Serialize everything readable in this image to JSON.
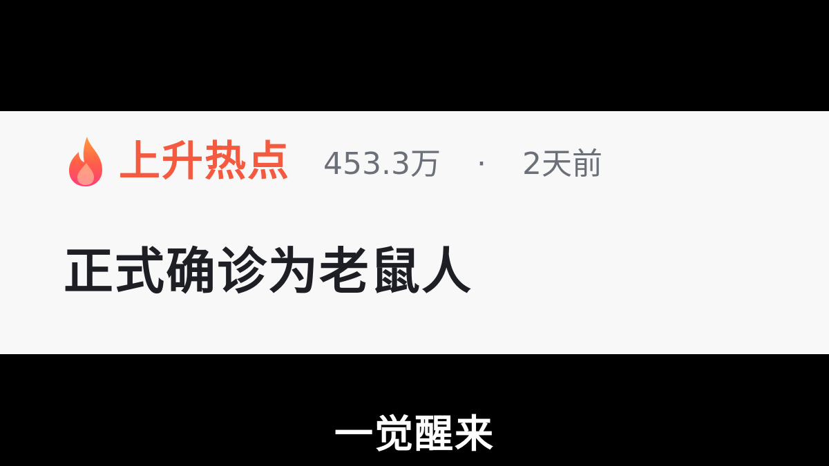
{
  "trending": {
    "icon": "flame-icon",
    "label": "上升热点",
    "label_color": "#f45a3f",
    "views": "453.3万",
    "separator": "·",
    "time_ago": "2天前",
    "headline": "正式确诊为老鼠人"
  },
  "caption": {
    "text": "一觉醒来"
  }
}
